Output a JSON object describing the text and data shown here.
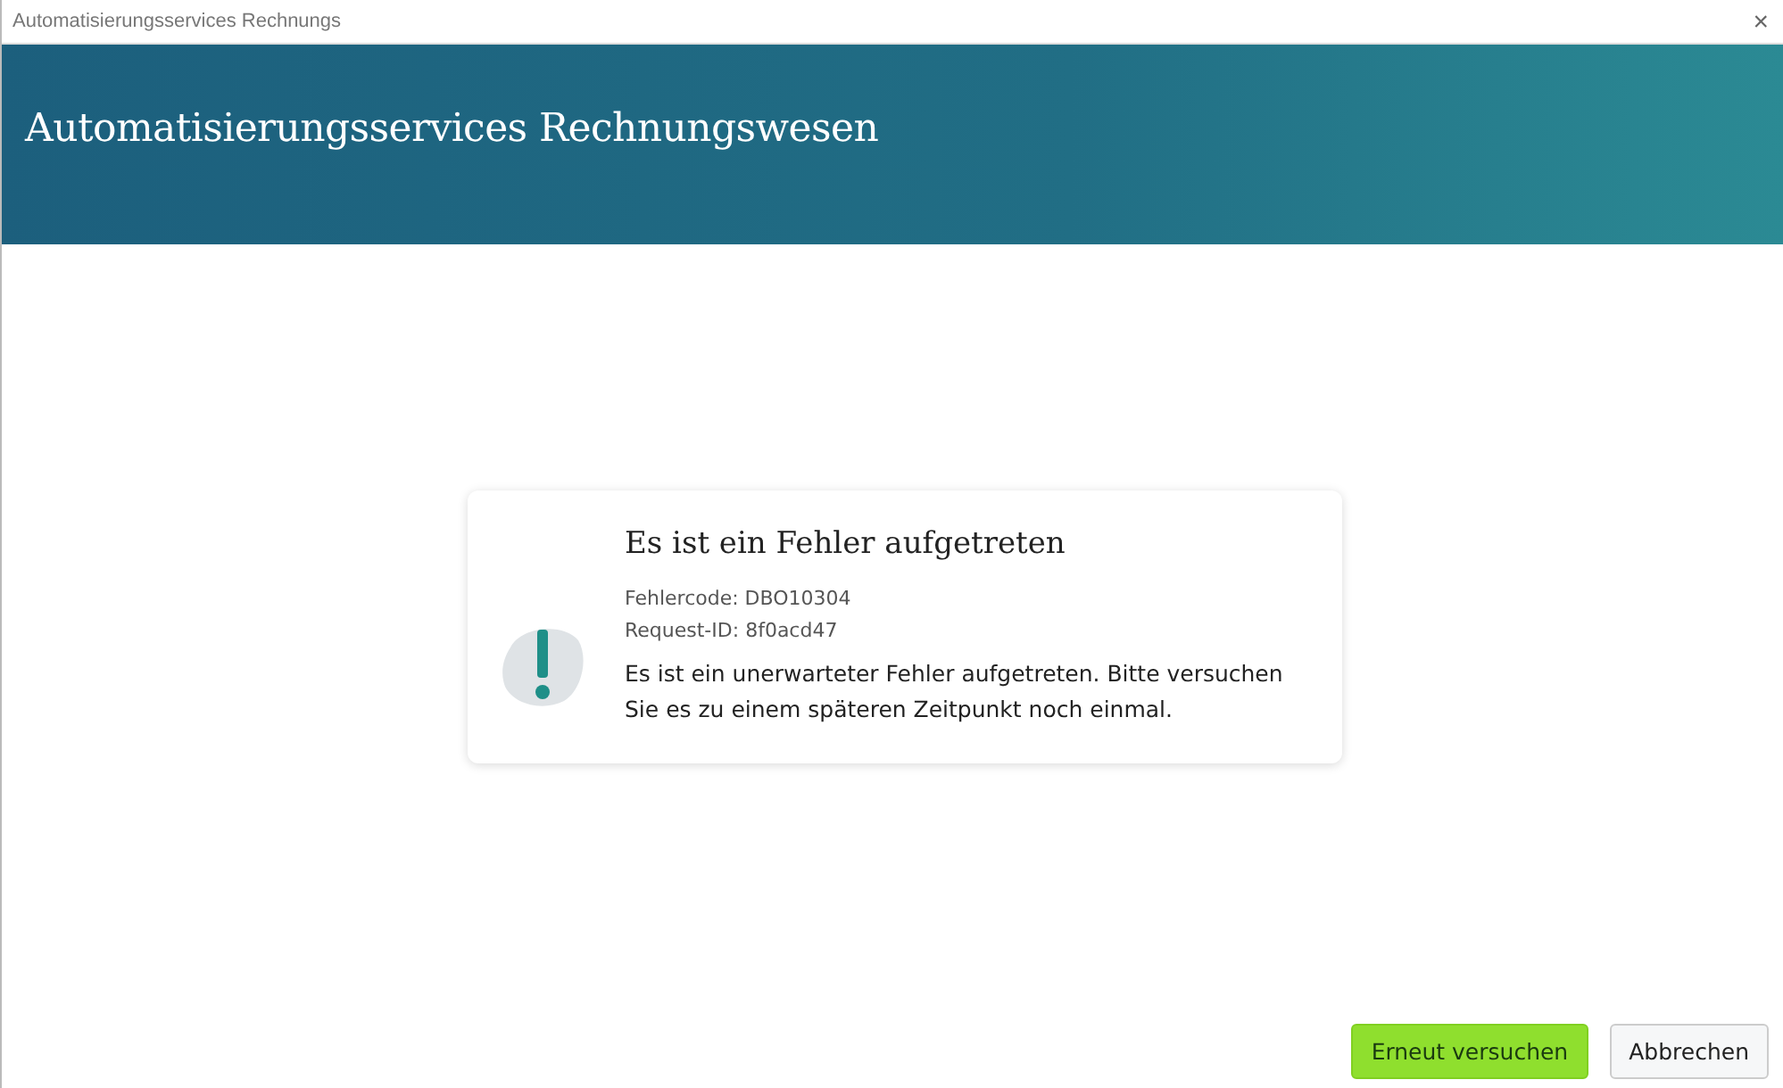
{
  "window": {
    "title": "Automatisierungsservices Rechnungs",
    "close": "×"
  },
  "header": {
    "title": "Automatisierungsservices Rechnungswesen"
  },
  "error": {
    "heading": "Es ist ein Fehler aufgetreten",
    "code": "Fehlercode: DBO10304",
    "request_id": "Request-ID: 8f0acd47",
    "message": "Es ist ein unerwarteter Fehler aufgetreten. Bitte versuchen Sie es zu einem späteren Zeitpunkt noch einmal."
  },
  "buttons": [
    {
      "label": "Erneut versuchen",
      "kind": "primary"
    },
    {
      "label": "Abbrechen",
      "kind": "secondary"
    }
  ]
}
